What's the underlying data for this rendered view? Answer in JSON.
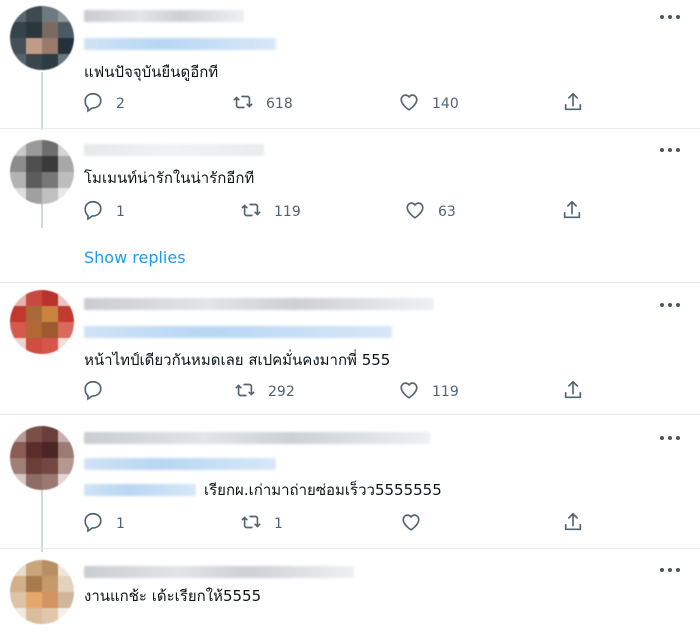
{
  "tweets": [
    {
      "text": "แฟนปัจจุบันยืนดูอีกที",
      "replies": "2",
      "retweets": "618",
      "likes": "140"
    },
    {
      "text": "โมเมนท์น่ารักในน่ารักอีกที",
      "replies": "1",
      "retweets": "119",
      "likes": "63"
    },
    {
      "text": "หน้าไทป์เดียวกันหมดเลย สเปคมั่นคงมากพี่ 555",
      "replies": "",
      "retweets": "292",
      "likes": "119"
    },
    {
      "text": "เรียกผ.เก่ามาถ่ายซ่อมเร็วว5555555",
      "replies": "1",
      "retweets": "1",
      "likes": ""
    },
    {
      "text": "งานแกช้ะ เด้ะเรียกให้5555"
    }
  ],
  "show_replies_label": "Show replies",
  "icons": {
    "reply": "reply-icon",
    "retweet": "retweet-icon",
    "like": "like-icon",
    "share": "share-icon",
    "more": "more-icon"
  },
  "colors": {
    "link": "#1d9bf0",
    "icon": "#536471",
    "divider": "#e6ecf0"
  }
}
